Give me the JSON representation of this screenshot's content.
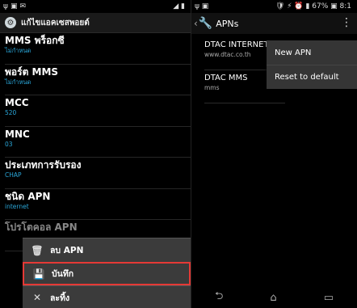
{
  "left": {
    "status": {
      "icons": [
        "ψ",
        "▣",
        "✉"
      ],
      "right": "◢ ▮"
    },
    "header_title": "แก้ไขแอคเซสพอยต์",
    "items": [
      {
        "title": "MMS พร็อกซี",
        "sub": "ไม่กำหนด"
      },
      {
        "title": "พอร์ต MMS",
        "sub": "ไม่กำหนด"
      },
      {
        "title": "MCC",
        "sub": "520"
      },
      {
        "title": "MNC",
        "sub": "03"
      },
      {
        "title": "ประเภทการรับรอง",
        "sub": "CHAP"
      },
      {
        "title": "ชนิด APN",
        "sub": "internet"
      },
      {
        "title": "โปรโตคอล APN",
        "sub": ""
      }
    ],
    "menu": [
      {
        "icon": "trash-icon",
        "glyph": "🗑",
        "label": "ลบ APN"
      },
      {
        "icon": "save-icon",
        "glyph": "💾",
        "label": "บันทึก"
      },
      {
        "icon": "close-icon",
        "glyph": "✕",
        "label": "ละทิ้ง"
      }
    ],
    "colors": {
      "highlight": "#e53935",
      "subtext": "#2aa6d8"
    }
  },
  "right": {
    "status": {
      "left": "ψ ▣",
      "right": "🛡 ⚡ ⏰ ▮ 67% ▣ 8:1"
    },
    "title": "APNs",
    "items": [
      {
        "title": "DTAC INTERNET",
        "sub": "www.dtac.co.th"
      },
      {
        "title": "DTAC MMS",
        "sub": "mms"
      }
    ],
    "menu": [
      {
        "label": "New APN"
      },
      {
        "label": "Reset to default"
      }
    ],
    "nav": {
      "back": "⮌",
      "home": "⌂",
      "recent": "▭"
    }
  }
}
